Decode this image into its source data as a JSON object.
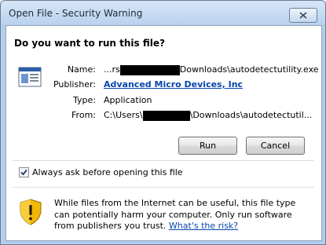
{
  "window": {
    "title": "Open File - Security Warning"
  },
  "dialog": {
    "question": "Do you want to run this file?",
    "name_label": "Name:",
    "name_prefix": "...rs",
    "name_suffix": "Downloads\\autodetectutility.exe",
    "publisher_label": "Publisher:",
    "publisher_value": "Advanced Micro Devices, Inc",
    "type_label": "Type:",
    "type_value": "Application",
    "from_label": "From:",
    "from_prefix": "C:\\Users\\",
    "from_suffix": "\\Downloads\\autodetectutil...",
    "run_label": "Run",
    "cancel_label": "Cancel",
    "checkbox_label": "Always ask before opening this file",
    "checkbox_checked": true,
    "warning_text": "While files from the Internet can be useful, this file type can potentially harm your computer. Only run software from publishers you trust.",
    "risk_link": "What's the risk?"
  },
  "icons": {
    "close": "close-icon",
    "file": "application-file-icon",
    "warning": "security-shield-warning-icon"
  },
  "colors": {
    "link": "#0645ad",
    "title_bar": "#b9d2ee",
    "shield": "#f2b705"
  }
}
